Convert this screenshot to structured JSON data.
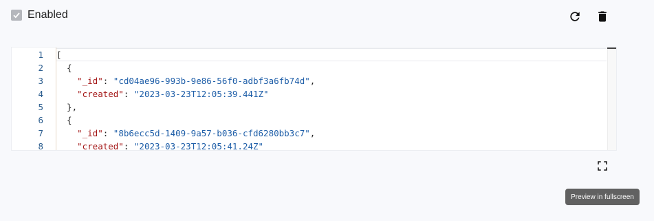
{
  "enabled": {
    "label": "Enabled",
    "checked": true
  },
  "toolbar": {
    "refresh_icon": "refresh-icon",
    "delete_icon": "trash-icon"
  },
  "editor": {
    "line_numbers": [
      "1",
      "2",
      "3",
      "4",
      "5",
      "6",
      "7",
      "8"
    ],
    "lines": [
      [
        {
          "t": "[",
          "c": "p"
        }
      ],
      [
        {
          "t": "  {",
          "c": "p"
        }
      ],
      [
        {
          "t": "    \"_id\"",
          "c": "k"
        },
        {
          "t": ": ",
          "c": "p"
        },
        {
          "t": "\"cd04ae96-993b-9e86-56f0-adbf3a6fb74d\"",
          "c": "s"
        },
        {
          "t": ",",
          "c": "p"
        }
      ],
      [
        {
          "t": "    \"created\"",
          "c": "k"
        },
        {
          "t": ": ",
          "c": "p"
        },
        {
          "t": "\"2023-03-23T12:05:39.441Z\"",
          "c": "s"
        }
      ],
      [
        {
          "t": "  },",
          "c": "p"
        }
      ],
      [
        {
          "t": "  {",
          "c": "p"
        }
      ],
      [
        {
          "t": "    \"_id\"",
          "c": "k"
        },
        {
          "t": ": ",
          "c": "p"
        },
        {
          "t": "\"8b6ecc5d-1409-9a57-b036-cfd6280bb3c7\"",
          "c": "s"
        },
        {
          "t": ",",
          "c": "p"
        }
      ],
      [
        {
          "t": "    \"created\"",
          "c": "k"
        },
        {
          "t": ": ",
          "c": "p"
        },
        {
          "t": "\"2023-03-23T12:05:41.24Z\"",
          "c": "s"
        }
      ]
    ]
  },
  "fullscreen": {
    "icon": "fullscreen-icon",
    "tooltip": "Preview in fullscreen"
  }
}
